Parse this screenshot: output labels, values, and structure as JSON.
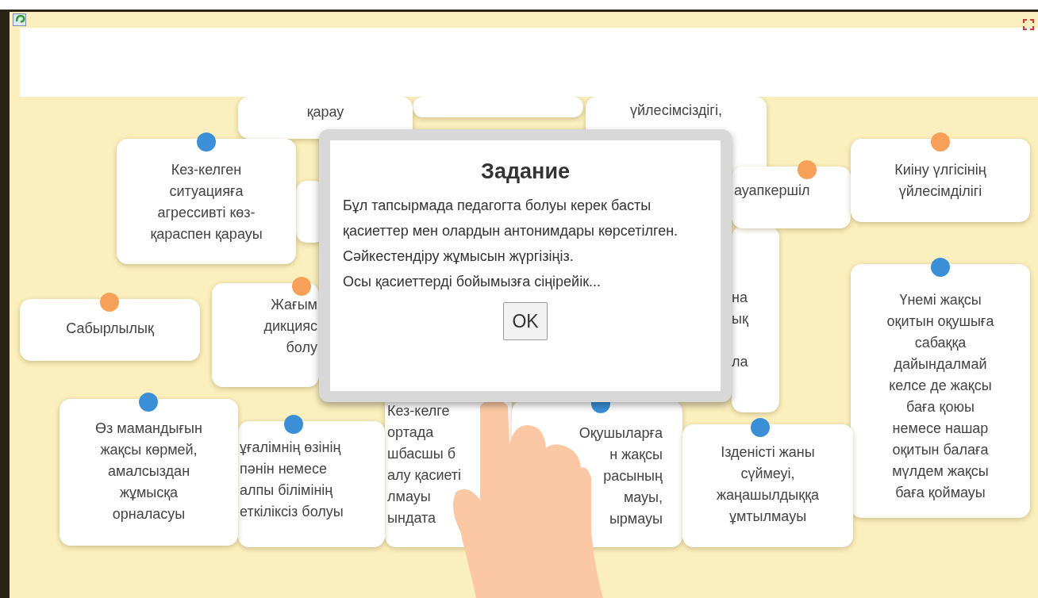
{
  "cards": [
    {
      "kind": "text",
      "text": "қарау"
    },
    {
      "kind": "blank"
    },
    {
      "kind": "text",
      "text": "үйлесімсіздігі,"
    },
    {
      "kind": "text",
      "text": "Кез-келген\nситуацияға\nагрессивті көз-\nқараспен қарауы",
      "color": "#3a8fd6"
    },
    {
      "kind": "blank"
    },
    {
      "kind": "text",
      "text": "ауапкершіл",
      "color": "#f6a05a"
    },
    {
      "kind": "text",
      "text": "Киіну үлгісінің\nүйлесімділігі",
      "color": "#f6a05a"
    },
    {
      "kind": "text",
      "text": "на\nық\n\nла"
    },
    {
      "kind": "text",
      "text": "Үнемі жақсы\nоқитын оқушыға\nсабаққа\nдайындалмай\nкелсе де жақсы\nбаға қоюы\nнемесе нашар\nоқитын балаға\nмүлдем жақсы\nбаға қоймауы",
      "color": "#3a8fd6"
    },
    {
      "kind": "text",
      "text": "Сабырлылық",
      "color": "#f6a05a"
    },
    {
      "kind": "text",
      "text": "Жағым\nдикцияс\nболу",
      "color": "#f6a05a"
    },
    {
      "kind": "text",
      "text": "Өз мамандығын\nжақсы көрмей,\nамалсыздан\nжұмысқа\nорналасуы",
      "color": "#3a8fd6"
    },
    {
      "kind": "text",
      "text": "ұғалімнің өзінің\nпәнін немесе\nалпы білімінің\nеткіліксіз болуы",
      "color": "#3a8fd6"
    },
    {
      "kind": "text",
      "text": "Кез-келге\nортада\nшбасшы б\nалу қасиеті\nлмауы\nындата"
    },
    {
      "kind": "text",
      "text": "Оқушыларға\nн жақсы\nрасының\nмауы,\nырмауы",
      "color": "#3a8fd6"
    },
    {
      "kind": "text",
      "text": "Ізденісті жаны\nсүймеуі,\nжаңашылдыққа\nұмтылмауы",
      "color": "#3a8fd6"
    }
  ],
  "modal": {
    "title": "Задание",
    "paragraphs": [
      "Бұл тапсырмада педагогта болуы керек басты қасиеттер мен олардын антонимдары көрсетілген.",
      "Сәйкестендіру жұмысын жүргізіңіз.",
      "Осы қасиеттерді бойымызға сіңірейік..."
    ],
    "button": "OK"
  }
}
